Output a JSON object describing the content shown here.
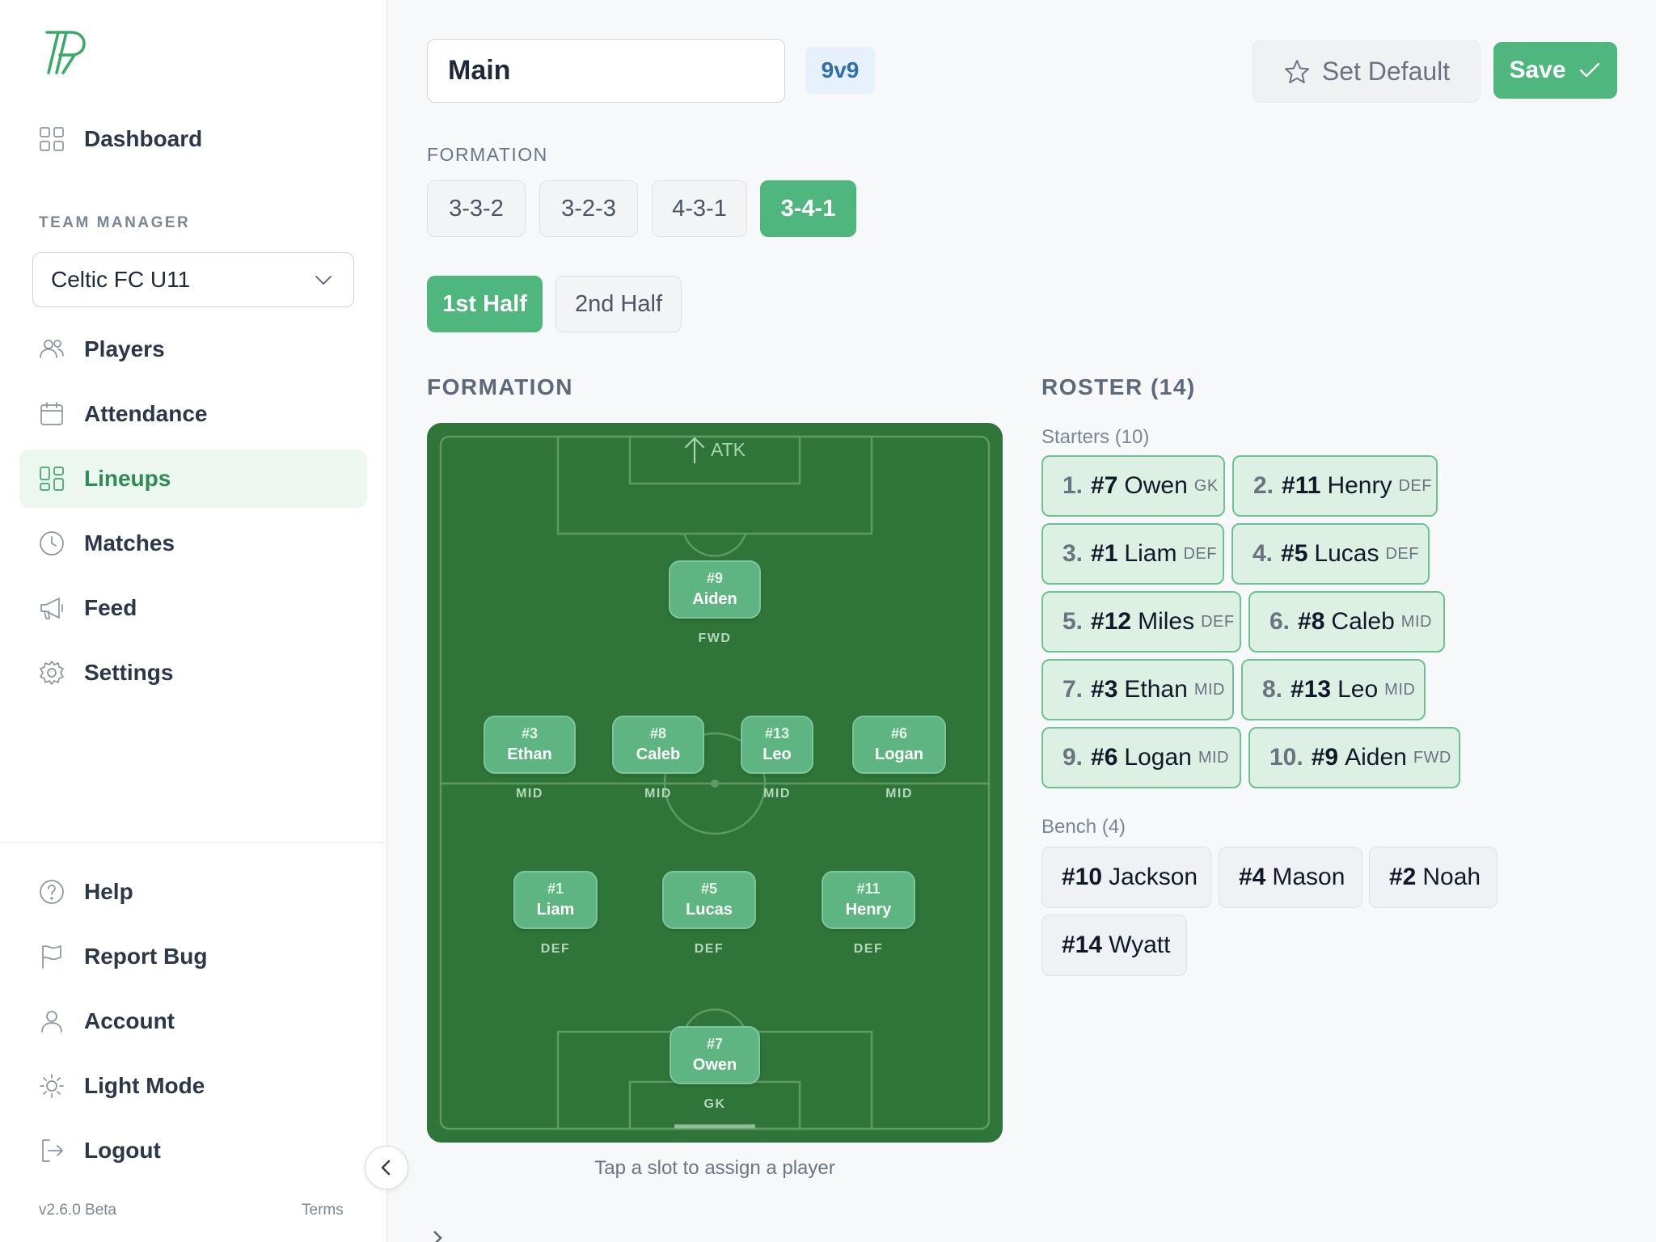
{
  "sidebar": {
    "nav": [
      {
        "label": "Dashboard",
        "icon": "dashboard-icon"
      }
    ],
    "section_label": "TEAM MANAGER",
    "team_select": {
      "value": "Celtic FC U11"
    },
    "manager_nav": [
      {
        "label": "Players",
        "icon": "players-icon"
      },
      {
        "label": "Attendance",
        "icon": "calendar-icon"
      },
      {
        "label": "Lineups",
        "icon": "lineups-icon",
        "active": true
      },
      {
        "label": "Matches",
        "icon": "clock-icon"
      },
      {
        "label": "Feed",
        "icon": "megaphone-icon"
      },
      {
        "label": "Settings",
        "icon": "gear-icon"
      }
    ],
    "bottom_nav": [
      {
        "label": "Help",
        "icon": "help-icon"
      },
      {
        "label": "Report Bug",
        "icon": "flag-icon"
      },
      {
        "label": "Account",
        "icon": "user-icon"
      },
      {
        "label": "Light Mode",
        "icon": "sun-icon"
      },
      {
        "label": "Logout",
        "icon": "logout-icon"
      }
    ],
    "version": "v2.6.0 Beta",
    "terms": "Terms"
  },
  "header": {
    "lineup_name": "Main",
    "size_badge": "9v9",
    "set_default_label": "Set Default",
    "save_label": "Save"
  },
  "formation_picker": {
    "label": "FORMATION",
    "options": [
      "3-3-2",
      "3-2-3",
      "4-3-1",
      "3-4-1"
    ],
    "selected": "3-4-1"
  },
  "halves": {
    "options": [
      "1st Half",
      "2nd Half"
    ],
    "selected": "1st Half"
  },
  "pitch": {
    "heading": "FORMATION",
    "attack_label": "ATK",
    "hint": "Tap a slot to assign a player",
    "slots": [
      {
        "number": "#9",
        "name": "Aiden",
        "position": "FWD"
      },
      {
        "number": "#3",
        "name": "Ethan",
        "position": "MID"
      },
      {
        "number": "#8",
        "name": "Caleb",
        "position": "MID"
      },
      {
        "number": "#13",
        "name": "Leo",
        "position": "MID"
      },
      {
        "number": "#6",
        "name": "Logan",
        "position": "MID"
      },
      {
        "number": "#1",
        "name": "Liam",
        "position": "DEF"
      },
      {
        "number": "#5",
        "name": "Lucas",
        "position": "DEF"
      },
      {
        "number": "#11",
        "name": "Henry",
        "position": "DEF"
      },
      {
        "number": "#7",
        "name": "Owen",
        "position": "GK"
      }
    ]
  },
  "roster": {
    "heading": "ROSTER (14)",
    "starters_label": "Starters (10)",
    "starters": [
      {
        "order": "1.",
        "number": "#7",
        "name": "Owen",
        "position": "GK"
      },
      {
        "order": "2.",
        "number": "#11",
        "name": "Henry",
        "position": "DEF"
      },
      {
        "order": "3.",
        "number": "#1",
        "name": "Liam",
        "position": "DEF"
      },
      {
        "order": "4.",
        "number": "#5",
        "name": "Lucas",
        "position": "DEF"
      },
      {
        "order": "5.",
        "number": "#12",
        "name": "Miles",
        "position": "DEF"
      },
      {
        "order": "6.",
        "number": "#8",
        "name": "Caleb",
        "position": "MID"
      },
      {
        "order": "7.",
        "number": "#3",
        "name": "Ethan",
        "position": "MID"
      },
      {
        "order": "8.",
        "number": "#13",
        "name": "Leo",
        "position": "MID"
      },
      {
        "order": "9.",
        "number": "#6",
        "name": "Logan",
        "position": "MID"
      },
      {
        "order": "10.",
        "number": "#9",
        "name": "Aiden",
        "position": "FWD"
      }
    ],
    "bench_label": "Bench (4)",
    "bench": [
      {
        "number": "#10",
        "name": "Jackson"
      },
      {
        "number": "#4",
        "name": "Mason"
      },
      {
        "number": "#2",
        "name": "Noah"
      },
      {
        "number": "#14",
        "name": "Wyatt"
      }
    ]
  },
  "colors": {
    "accent": "#4fb67d",
    "pitch": "#2f7539",
    "badge": "#2f6ea8"
  }
}
